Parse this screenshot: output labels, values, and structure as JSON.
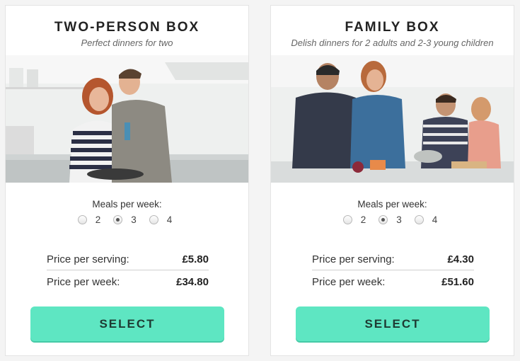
{
  "plans": [
    {
      "title": "TWO-PERSON BOX",
      "subtitle": "Perfect dinners for two",
      "meals_label": "Meals per week:",
      "meal_options": [
        "2",
        "3",
        "4"
      ],
      "selected_meals": "3",
      "price_serving_label": "Price per serving:",
      "price_serving": "£5.80",
      "price_week_label": "Price per week:",
      "price_week": "£34.80",
      "select_label": "SELECT"
    },
    {
      "title": "FAMILY BOX",
      "subtitle": "Delish dinners for 2 adults and 2-3 young children",
      "meals_label": "Meals per week:",
      "meal_options": [
        "2",
        "3",
        "4"
      ],
      "selected_meals": "3",
      "price_serving_label": "Price per serving:",
      "price_serving": "£4.30",
      "price_week_label": "Price per week:",
      "price_week": "£51.60",
      "select_label": "SELECT"
    }
  ],
  "colors": {
    "accent": "#5ee6c2",
    "page_bg": "#f4f4f4"
  },
  "icons": {
    "radio": "radio-button"
  }
}
